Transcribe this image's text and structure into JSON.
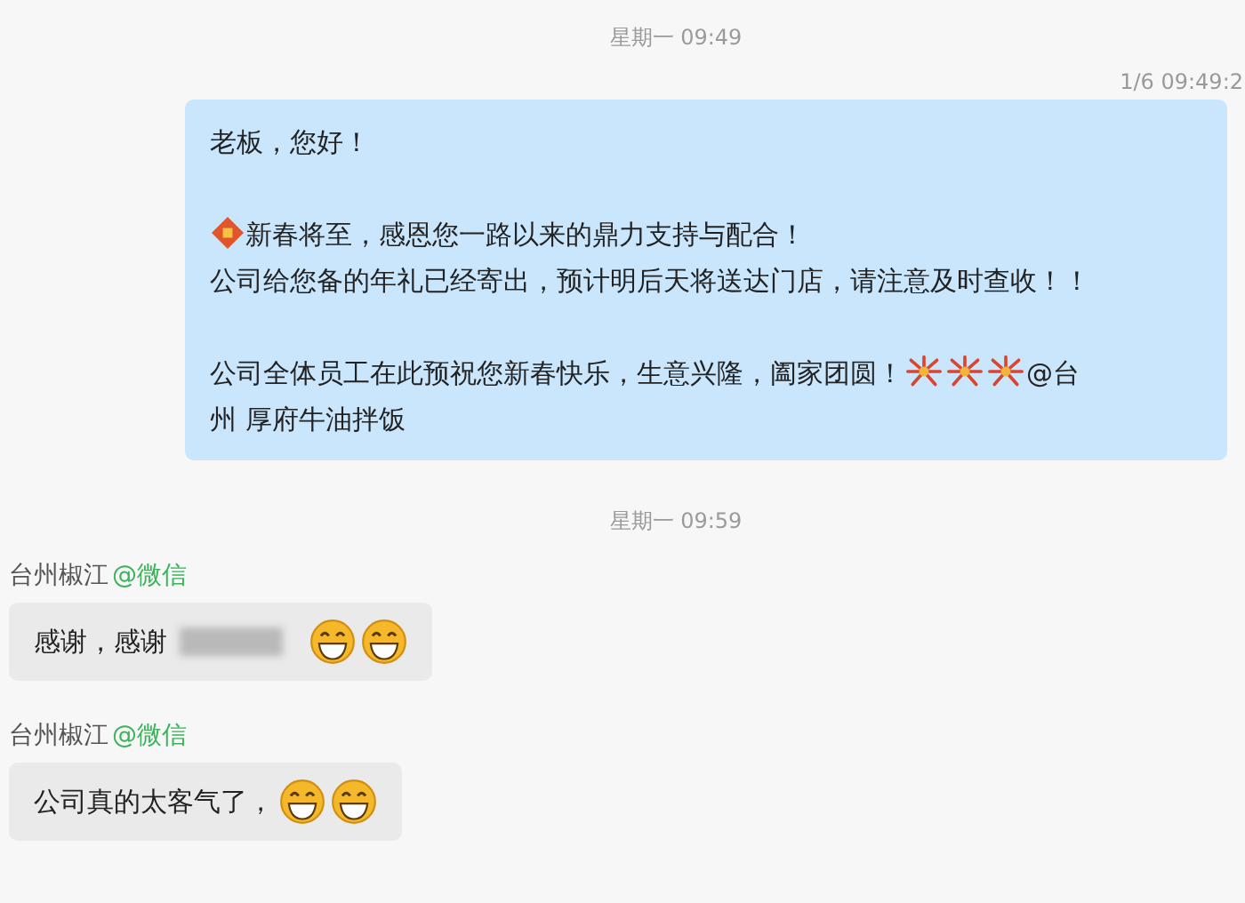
{
  "chat": [
    {
      "kind": "separator",
      "text": "星期一 09:49"
    },
    {
      "kind": "outgoing",
      "time": "1/6 09:49:2",
      "blocks": [
        [
          [
            {
              "kind": "text",
              "text": "老板，您好！"
            }
          ]
        ],
        [
          [
            {
              "kind": "sticker"
            },
            {
              "kind": "text",
              "text": "新春将至，感恩您一路以来的鼎力支持与配合！"
            }
          ],
          [
            {
              "kind": "text",
              "text": "公司给您备的年礼已经寄出，预计明后天将送达门店，请注意及时查收！！"
            }
          ]
        ],
        [
          [
            {
              "kind": "text",
              "text": "公司全体员工在此预祝您新春快乐，生意兴隆，阖家团圆！"
            },
            {
              "kind": "firework"
            },
            {
              "kind": "firework"
            },
            {
              "kind": "firework"
            },
            {
              "kind": "text",
              "text": "@台"
            }
          ],
          [
            {
              "kind": "text",
              "text": "州 厚府牛油拌饭"
            }
          ]
        ]
      ]
    },
    {
      "kind": "separator",
      "text": "星期一 09:59"
    },
    {
      "kind": "incoming",
      "sender": "台州椒江",
      "source": "@微信",
      "segments": [
        {
          "kind": "text",
          "text": "感谢，感谢"
        },
        {
          "kind": "blur"
        },
        {
          "kind": "grin"
        },
        {
          "kind": "grin"
        }
      ]
    },
    {
      "kind": "incoming",
      "sender": "台州椒江",
      "source": "@微信",
      "segments": [
        {
          "kind": "text",
          "text": "公司真的太客气了，"
        },
        {
          "kind": "grin"
        },
        {
          "kind": "grin"
        }
      ]
    }
  ]
}
